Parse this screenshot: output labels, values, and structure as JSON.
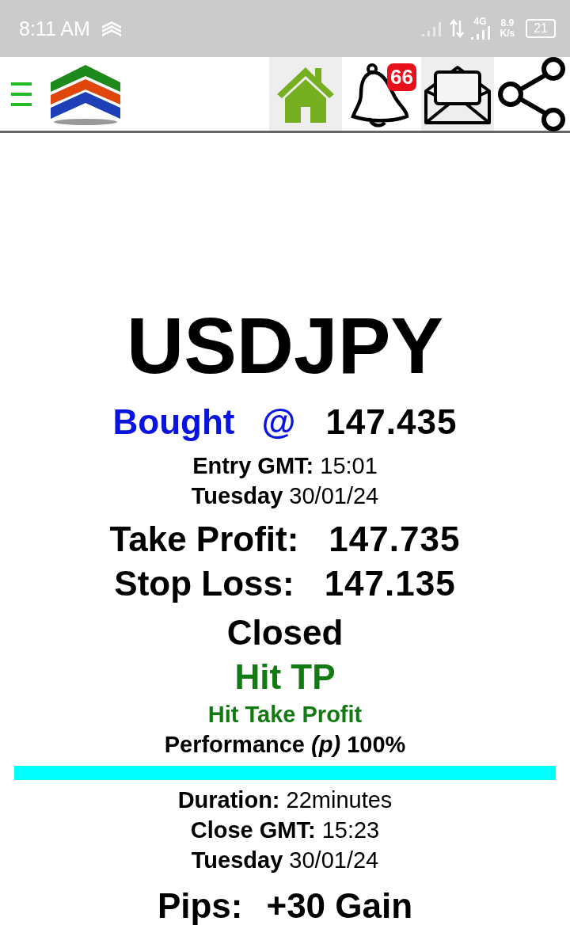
{
  "status_bar": {
    "time": "8:11 AM",
    "network": "4G",
    "speed_value": "8.9",
    "speed_unit": "K/s",
    "battery": "21"
  },
  "header": {
    "notification_count": "66"
  },
  "trade": {
    "symbol": "USDJPY",
    "direction": "Bought",
    "at": "@",
    "entry_price": "147.435",
    "entry_time": "**Entry GMT:** 15:01",
    "entry_date": "**Tuesday** 30/01/24",
    "take_profit_label": "Take Profit:",
    "take_profit": "147.735",
    "stop_loss_label": "Stop Loss:",
    "stop_loss": "147.135",
    "status": "Closed",
    "result": "Hit TP",
    "result_detail": "Hit Take Profit",
    "performance": "Performance *(p)* 100%",
    "duration": "**Duration:** 22minutes",
    "close_time": "**Close GMT:** 15:23",
    "close_date": "**Tuesday** 30/01/24",
    "pips_label": "Pips:",
    "pips": "+30 Gain"
  }
}
